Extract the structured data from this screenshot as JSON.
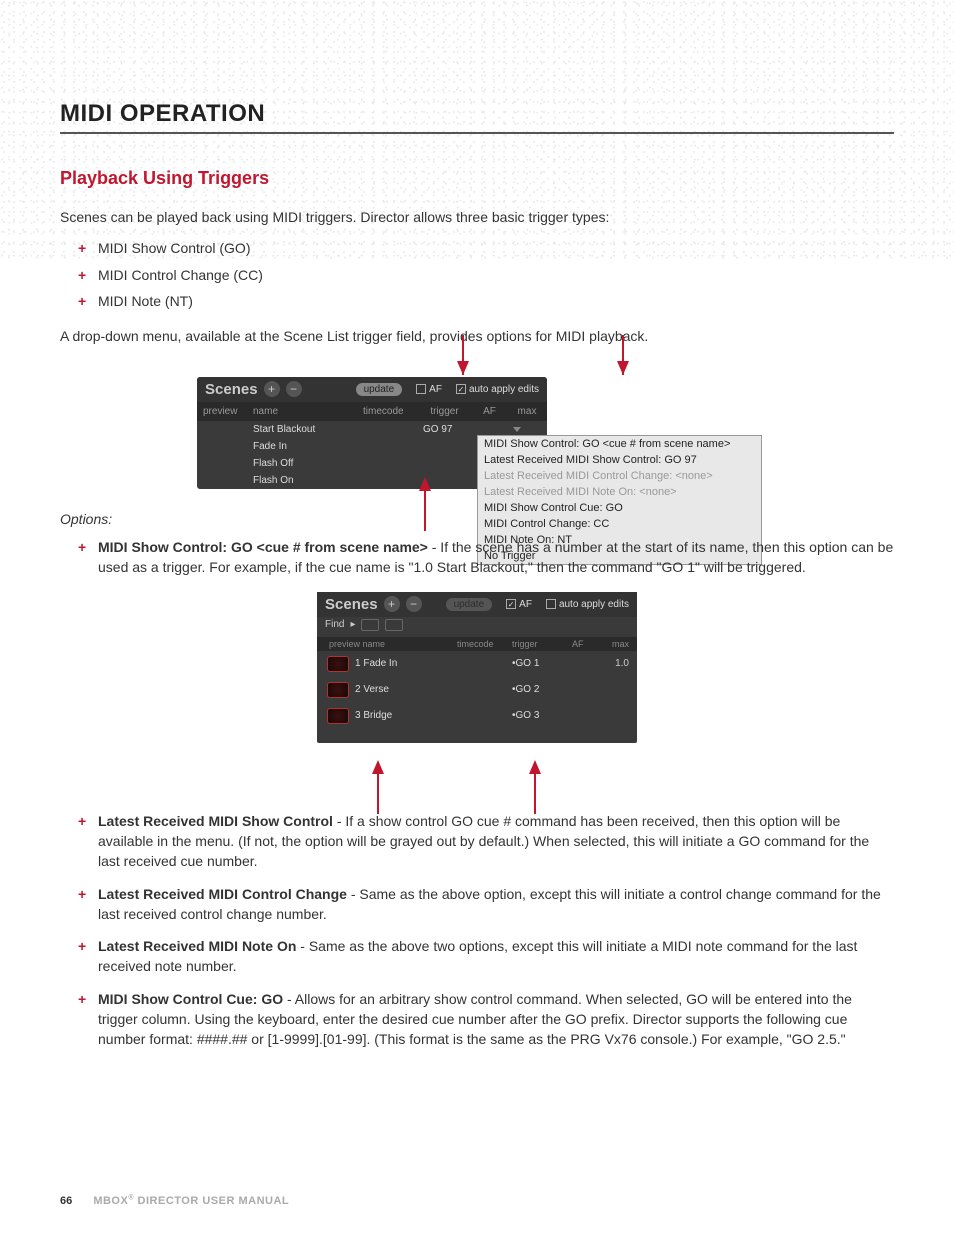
{
  "header": {
    "title": "MIDI OPERATION"
  },
  "section": {
    "title": "Playback Using Triggers",
    "intro": "Scenes can be played back using MIDI triggers. Director allows three basic trigger types:",
    "triggers": [
      "MIDI Show Control (GO)",
      "MIDI Control Change (CC)",
      "MIDI Note (NT)"
    ],
    "after": "A drop-down menu, available at the Scene List trigger field, provides options for MIDI playback."
  },
  "shot1": {
    "panel_title": "Scenes",
    "update": "update",
    "af": "AF",
    "auto_apply": "auto apply edits",
    "cols": {
      "preview": "preview",
      "name": "name",
      "timecode": "timecode",
      "trigger": "trigger",
      "af": "AF",
      "max": "max"
    },
    "rows": [
      {
        "name": "Start Blackout",
        "trigger": "GO 97"
      },
      {
        "name": "Fade In",
        "trigger": ""
      },
      {
        "name": "Flash Off",
        "trigger": ""
      },
      {
        "name": "Flash On",
        "trigger": ""
      }
    ],
    "dropdown": [
      {
        "text": "MIDI Show Control: GO <cue # from scene name>",
        "gray": false
      },
      {
        "text": "Latest Received MIDI Show Control: GO 97",
        "gray": false
      },
      {
        "text": "Latest Received MIDI Control Change: <none>",
        "gray": true
      },
      {
        "text": "Latest Received MIDI Note On: <none>",
        "gray": true
      },
      {
        "text": "MIDI Show Control Cue: GO",
        "gray": false
      },
      {
        "text": "MIDI Control Change: CC",
        "gray": false
      },
      {
        "text": "MIDI Note On: NT",
        "gray": false
      },
      {
        "text": "No Trigger",
        "gray": false
      }
    ]
  },
  "options_label": "Options:",
  "options": [
    {
      "bold": "MIDI Show Control: GO <cue # from scene name>",
      "text": " - If the scene has a number at the start of its name, then this option can be used as a trigger. For example, if the cue name is \"1.0 Start Blackout,\" then the command \"GO 1\" will be triggered."
    },
    {
      "bold": "Latest Received MIDI Show Control",
      "text": " - If a show control GO cue # command has been received, then this option will be available in the menu. (If not, the option will be grayed out by default.) When selected, this will initiate a GO command for the last received cue number."
    },
    {
      "bold": "Latest Received MIDI Control Change",
      "text": " - Same as the above option, except this will initiate a control change command for the last received control change number."
    },
    {
      "bold": "Latest Received MIDI Note On",
      "text": " - Same as the above two options, except this will initiate a MIDI note command for the last received note number."
    },
    {
      "bold": "MIDI Show Control Cue: GO",
      "text": " - Allows for an arbitrary show control command. When selected, GO will be entered into the trigger column. Using the keyboard, enter the desired cue number after the GO prefix. Director supports the following cue number format: ####.## or [1-9999].[01-99]. (This format is the same as the PRG Vx76 console.) For example, \"GO 2.5.\""
    }
  ],
  "shot2": {
    "panel_title": "Scenes",
    "update": "update",
    "af": "AF",
    "auto_apply": "auto apply edits",
    "find": "Find",
    "cols": {
      "name": "preview name",
      "timecode": "timecode",
      "trigger": "trigger",
      "af": "AF",
      "max": "max"
    },
    "rows": [
      {
        "name": "1 Fade In",
        "trigger": "•GO 1",
        "max": "1.0"
      },
      {
        "name": "2 Verse",
        "trigger": "•GO 2",
        "max": ""
      },
      {
        "name": "3 Bridge",
        "trigger": "•GO 3",
        "max": ""
      }
    ]
  },
  "footer": {
    "page": "66",
    "title": "MBOX",
    "sub": "DIRECTOR USER MANUAL"
  }
}
